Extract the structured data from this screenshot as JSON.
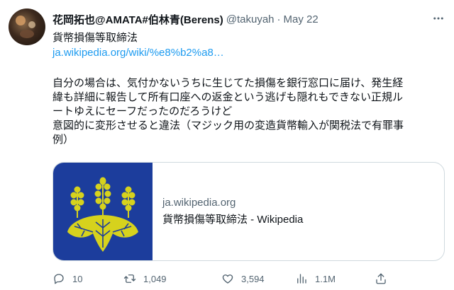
{
  "tweet": {
    "display_name": "花岡拓也@AMATA#伯林青(Berens)",
    "handle": "@takuyah",
    "separator": "·",
    "date": "May 22",
    "title": "貨幣損傷等取締法",
    "link": "ja.wikipedia.org/wiki/%e8%b2%a8…",
    "body": "自分の場合は、気付かないうちに生じてた損傷を銀行窓口に届け、発生経\n緯も詳細に報告して所有口座への返金という逃げも隠れもできない正規ル\nートゆえにセーフだったのだろうけど\n意図的に変形させると違法（マジック用の変造貨幣輸入が関税法で有罪事\n例）",
    "icon_more": "more-icon"
  },
  "card": {
    "domain": "ja.wikipedia.org",
    "title": "貨幣損傷等取締法 - Wikipedia",
    "thumb_bg": "#1c3d9c",
    "emblem_color": "#d6d21d",
    "icon": "paulownia-emblem-icon"
  },
  "actions": {
    "reply": {
      "icon": "reply-icon",
      "count": "10"
    },
    "retweet": {
      "icon": "retweet-icon",
      "count": "1,049"
    },
    "like": {
      "icon": "like-icon",
      "count": "3,594"
    },
    "views": {
      "icon": "views-icon",
      "count": "1.1M"
    },
    "share": {
      "icon": "share-icon"
    }
  },
  "colors": {
    "accent": "#1d9bf0",
    "secondary_text": "#536471",
    "border": "#cfd9de"
  }
}
